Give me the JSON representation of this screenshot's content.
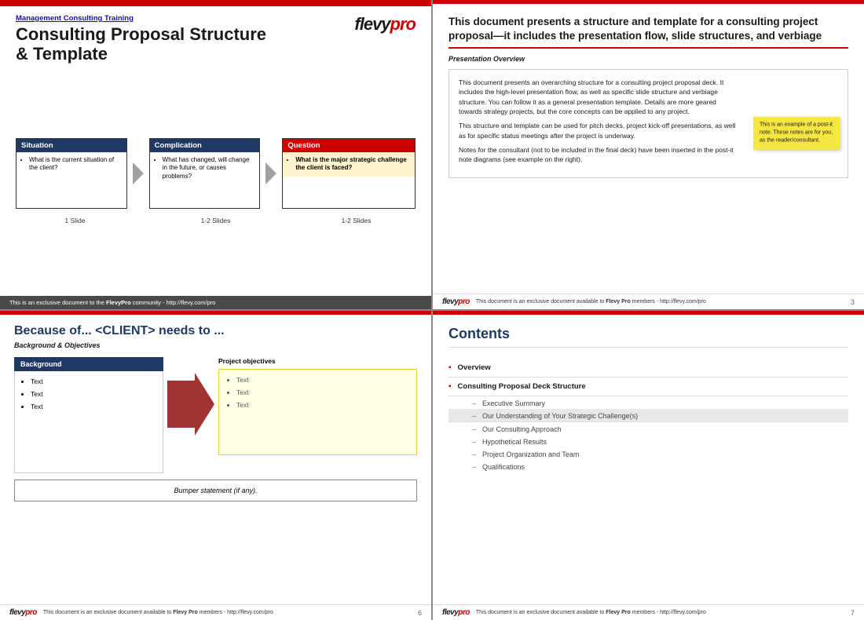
{
  "slide1": {
    "topbar_color": "#cc0000",
    "subtitle_link": "Management Consulting Training",
    "main_title": "Consulting Proposal Structure\n& Template",
    "logo_text_dark": "flevy",
    "logo_text_red": "pro",
    "flow_boxes": [
      {
        "id": "situation",
        "header": "Situation",
        "body": "What is the current situation of the client?",
        "accent": "#1f3864",
        "slide_count": "1 Slide"
      },
      {
        "id": "complication",
        "header": "Complication",
        "body": "What has changed, will change in the future, or causes problems?",
        "accent": "#1f3864",
        "slide_count": "1-2 Slides"
      },
      {
        "id": "question",
        "header": "Question",
        "body": "What is the major strategic challenge the client is faced?",
        "accent": "#cc0000",
        "slide_count": "1-2 Slides",
        "highlight": true
      }
    ],
    "footer_text": "This is an exclusive document to the ",
    "footer_bold": "FlevyPro",
    "footer_suffix": " community - http://flevy.com/pro"
  },
  "slide2": {
    "big_title": "This document presents a structure and template for a consulting project proposal—it includes the presentation flow, slide structures, and verbiage",
    "section_label": "Presentation Overview",
    "overview_paragraphs": [
      "This document presents an overarching structure for a consulting project proposal deck.  It includes the high-level presentation flow, as well as specific slide structure and verbiage structure.  You can follow it as a general presentation template.  Details are more geared towards strategy projects, but the core concepts can be applied to any project.",
      "This structure and template can be used for pitch decks, project kick-off presentations, as well as for specific status meetings after the project is underway.",
      "Notes for the consultant (not to be included in the final deck) have been inserted in the post-it note diagrams (see example on the right)."
    ],
    "sticky_note_text": "This is an example of a post-it note.  These notes are for you, as the reader/consultant.",
    "footer_logo_dark": "flevy",
    "footer_logo_red": "pro",
    "footer_text": "This document is an exclusive document available to ",
    "footer_bold": "Flevy Pro",
    "footer_suffix": " members - http://flevy.com/pro",
    "page_num": "3"
  },
  "slide3": {
    "slide_title": "Because of... <CLIENT> needs to ...",
    "section_label": "Background & Objectives",
    "bg_box_header": "Background",
    "bg_items": [
      "Text",
      "Text",
      "Text"
    ],
    "proj_obj_label": "Project objectives",
    "proj_obj_items": [
      "Text",
      "Text",
      "Text"
    ],
    "bumper_text": "Bumper statement (if any).",
    "footer_logo_dark": "flevy",
    "footer_logo_red": "pro",
    "footer_text": "This document is an exclusive document available to ",
    "footer_bold": "Flevy Pro",
    "footer_suffix": " members - http://flevy.com/pro",
    "page_num": "6"
  },
  "slide4": {
    "slide_title": "Contents",
    "top_items": [
      {
        "label": "Overview",
        "bullet": "▪",
        "sub_items": []
      },
      {
        "label": "Consulting Proposal Deck Structure",
        "bullet": "▪",
        "sub_items": [
          {
            "text": "Executive Summary",
            "highlighted": false
          },
          {
            "text": "Our Understanding of Your Strategic Challenge(s)",
            "highlighted": true
          },
          {
            "text": "Our Consulting Approach",
            "highlighted": false
          },
          {
            "text": "Hypothetical Results",
            "highlighted": false
          },
          {
            "text": "Project Organization and Team",
            "highlighted": false
          },
          {
            "text": "Qualifications",
            "highlighted": false
          }
        ]
      }
    ],
    "footer_logo_dark": "flevy",
    "footer_logo_red": "pro",
    "footer_text": "This document is an exclusive document available to ",
    "footer_bold": "Flevy Pro",
    "footer_suffix": " members - http://flevy.com/pro",
    "page_num": "7"
  }
}
